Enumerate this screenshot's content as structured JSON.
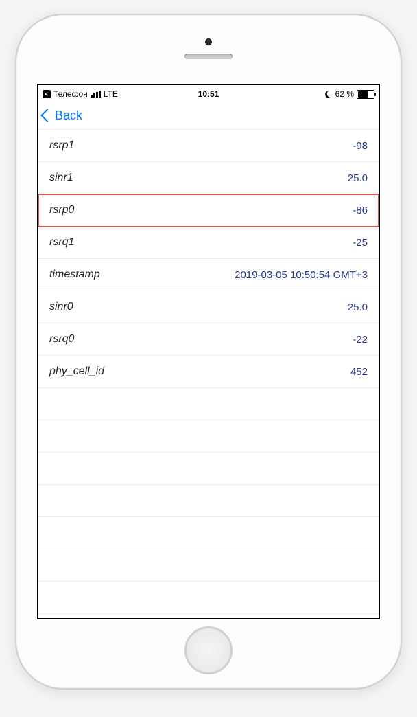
{
  "status_bar": {
    "carrier_label": "Телефон",
    "network": "LTE",
    "time": "10:51",
    "battery_percent": "62 %"
  },
  "nav": {
    "back_label": "Back"
  },
  "rows": [
    {
      "label": "rsrp1",
      "value": "-98",
      "highlight": false
    },
    {
      "label": "sinr1",
      "value": "25.0",
      "highlight": false
    },
    {
      "label": "rsrp0",
      "value": "-86",
      "highlight": true
    },
    {
      "label": "rsrq1",
      "value": "-25",
      "highlight": false
    },
    {
      "label": "timestamp",
      "value": "2019-03-05 10:50:54 GMT+3",
      "highlight": false
    },
    {
      "label": "sinr0",
      "value": "25.0",
      "highlight": false
    },
    {
      "label": "rsrq0",
      "value": "-22",
      "highlight": false
    },
    {
      "label": "phy_cell_id",
      "value": "452",
      "highlight": false
    }
  ],
  "empty_rows": 8
}
